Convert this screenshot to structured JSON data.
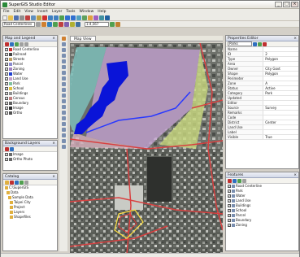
{
  "window": {
    "title": "SuperGIS Studio Editor"
  },
  "menu": [
    "File",
    "Edit",
    "View",
    "Insert",
    "Layer",
    "Tools",
    "Window",
    "Help"
  ],
  "toolbar": {
    "layer_combo": "Road Centerlines",
    "scale_combo": "1:4,567"
  },
  "layer_panel": {
    "title": "Map and Legend",
    "layers": [
      {
        "label": "Road Centerline",
        "checked": true,
        "color": "#d03030"
      },
      {
        "label": "Railroad",
        "checked": true,
        "color": "#444444"
      },
      {
        "label": "Streets",
        "checked": true,
        "color": "#c0a060"
      },
      {
        "label": "Parcel",
        "checked": true,
        "color": "#8888cc"
      },
      {
        "label": "Zoning",
        "checked": true,
        "color": "#a080c0"
      },
      {
        "label": "Water",
        "checked": true,
        "color": "#2040d0"
      },
      {
        "label": "Land Use",
        "checked": true,
        "color": "#c4a0c8"
      },
      {
        "label": "Park",
        "checked": true,
        "color": "#80c0a0"
      },
      {
        "label": "School",
        "checked": true,
        "color": "#e0c040"
      },
      {
        "label": "Buildings",
        "checked": true,
        "color": "#909090"
      },
      {
        "label": "Census",
        "checked": true,
        "color": "#c08080"
      },
      {
        "label": "Boundary",
        "checked": true,
        "color": "#606060"
      },
      {
        "label": "Image",
        "checked": true,
        "color": "#303030"
      },
      {
        "label": "Ortho",
        "checked": true,
        "color": "#505050"
      }
    ]
  },
  "background_panel": {
    "title": "Background Layers",
    "items": [
      {
        "label": "Image"
      },
      {
        "label": "Ortho Photo"
      }
    ]
  },
  "catalog_panel": {
    "title": "Catalog",
    "items": [
      {
        "label": "C:\\SuperGIS"
      },
      {
        "label": "Data"
      },
      {
        "label": "Sample Data"
      },
      {
        "label": "Taipei City"
      },
      {
        "label": "Project"
      },
      {
        "label": "Layers"
      },
      {
        "label": "Shapefiles"
      }
    ]
  },
  "map": {
    "tab_label": "Map View"
  },
  "properties_panel": {
    "title": "Properties Editor",
    "dropdown_value": "Parks",
    "rows": [
      {
        "k": "Name",
        "v": ""
      },
      {
        "k": "ID",
        "v": "2"
      },
      {
        "k": "Type",
        "v": "Polygon"
      },
      {
        "k": "Area",
        "v": ""
      },
      {
        "k": "Owner",
        "v": "City Govt"
      },
      {
        "k": "Shape",
        "v": "Polygon"
      },
      {
        "k": "Perimeter",
        "v": ""
      },
      {
        "k": "Zone",
        "v": "A"
      },
      {
        "k": "Status",
        "v": "Active"
      },
      {
        "k": "Category",
        "v": "Park"
      },
      {
        "k": "Updated",
        "v": ""
      },
      {
        "k": "Editor",
        "v": ""
      },
      {
        "k": "Source",
        "v": "Survey"
      },
      {
        "k": "Remarks",
        "v": ""
      },
      {
        "k": "Code",
        "v": ""
      },
      {
        "k": "District",
        "v": "Center"
      },
      {
        "k": "Land Use",
        "v": ""
      },
      {
        "k": "Label",
        "v": ""
      },
      {
        "k": "Visible",
        "v": "True"
      }
    ]
  },
  "symbol_panel": {
    "title": "Features",
    "items": [
      {
        "label": "Road Centerline"
      },
      {
        "label": "Park"
      },
      {
        "label": "Water"
      },
      {
        "label": "Land Use"
      },
      {
        "label": "Buildings"
      },
      {
        "label": "School"
      },
      {
        "label": "Parcel"
      },
      {
        "label": "Boundary"
      },
      {
        "label": "Zoning"
      }
    ]
  }
}
